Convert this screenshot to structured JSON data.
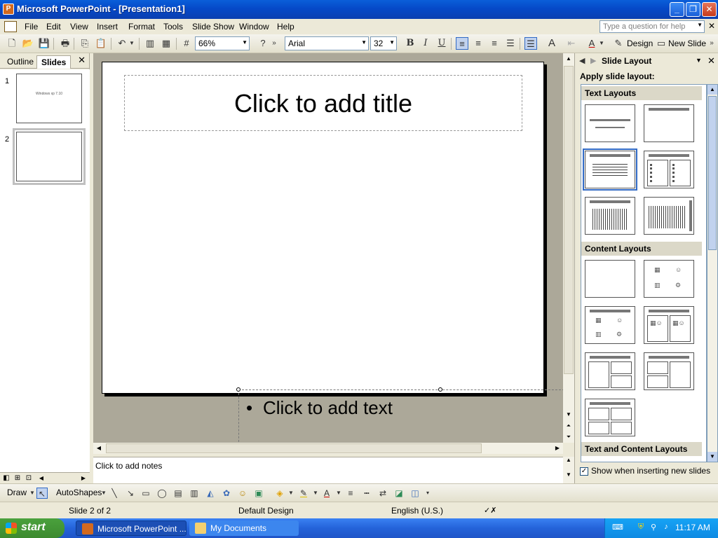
{
  "window": {
    "title": "Microsoft PowerPoint - [Presentation1]",
    "min_label": "_",
    "max_label": "❐",
    "close_label": "✕"
  },
  "menu": {
    "items": [
      "File",
      "Edit",
      "View",
      "Insert",
      "Format",
      "Tools",
      "Slide Show",
      "Window",
      "Help"
    ],
    "help_placeholder": "Type a question for help",
    "close_label": "✕"
  },
  "toolbar": {
    "zoom": "66%",
    "font": "Arial",
    "font_size": "32",
    "bold": "B",
    "italic": "I",
    "underline": "U",
    "design_label": "Design",
    "new_slide_label": "New Slide"
  },
  "left_pane": {
    "tab_outline": "Outline",
    "tab_slides": "Slides",
    "close_label": "✕",
    "slides": [
      {
        "number": "1",
        "text": "Windows xp 7.10"
      },
      {
        "number": "2",
        "text": ""
      }
    ]
  },
  "slide": {
    "title_placeholder": "Click to add title",
    "bullet": "•",
    "body_placeholder": "Click to add text"
  },
  "notes": {
    "placeholder": "Click to add notes"
  },
  "task_pane": {
    "title": "Slide Layout",
    "apply_label": "Apply slide layout:",
    "sections": [
      "Text Layouts",
      "Content Layouts",
      "Text and Content Layouts"
    ],
    "show_checkbox_label": "Show when inserting new slides",
    "show_checked": true
  },
  "draw_toolbar": {
    "draw_label": "Draw",
    "autoshapes_label": "AutoShapes"
  },
  "status": {
    "slide_position": "Slide 2 of 2",
    "design": "Default Design",
    "language": "English (U.S.)"
  },
  "taskbar": {
    "start_label": "start",
    "tasks": [
      "Microsoft PowerPoint ...",
      "My Documents"
    ],
    "clock": "11:17 AM"
  },
  "colors": {
    "titlebar": "#0549c8",
    "taskbar": "#2463d9",
    "start": "#3c8a2f",
    "tray": "#0e8ae3"
  }
}
